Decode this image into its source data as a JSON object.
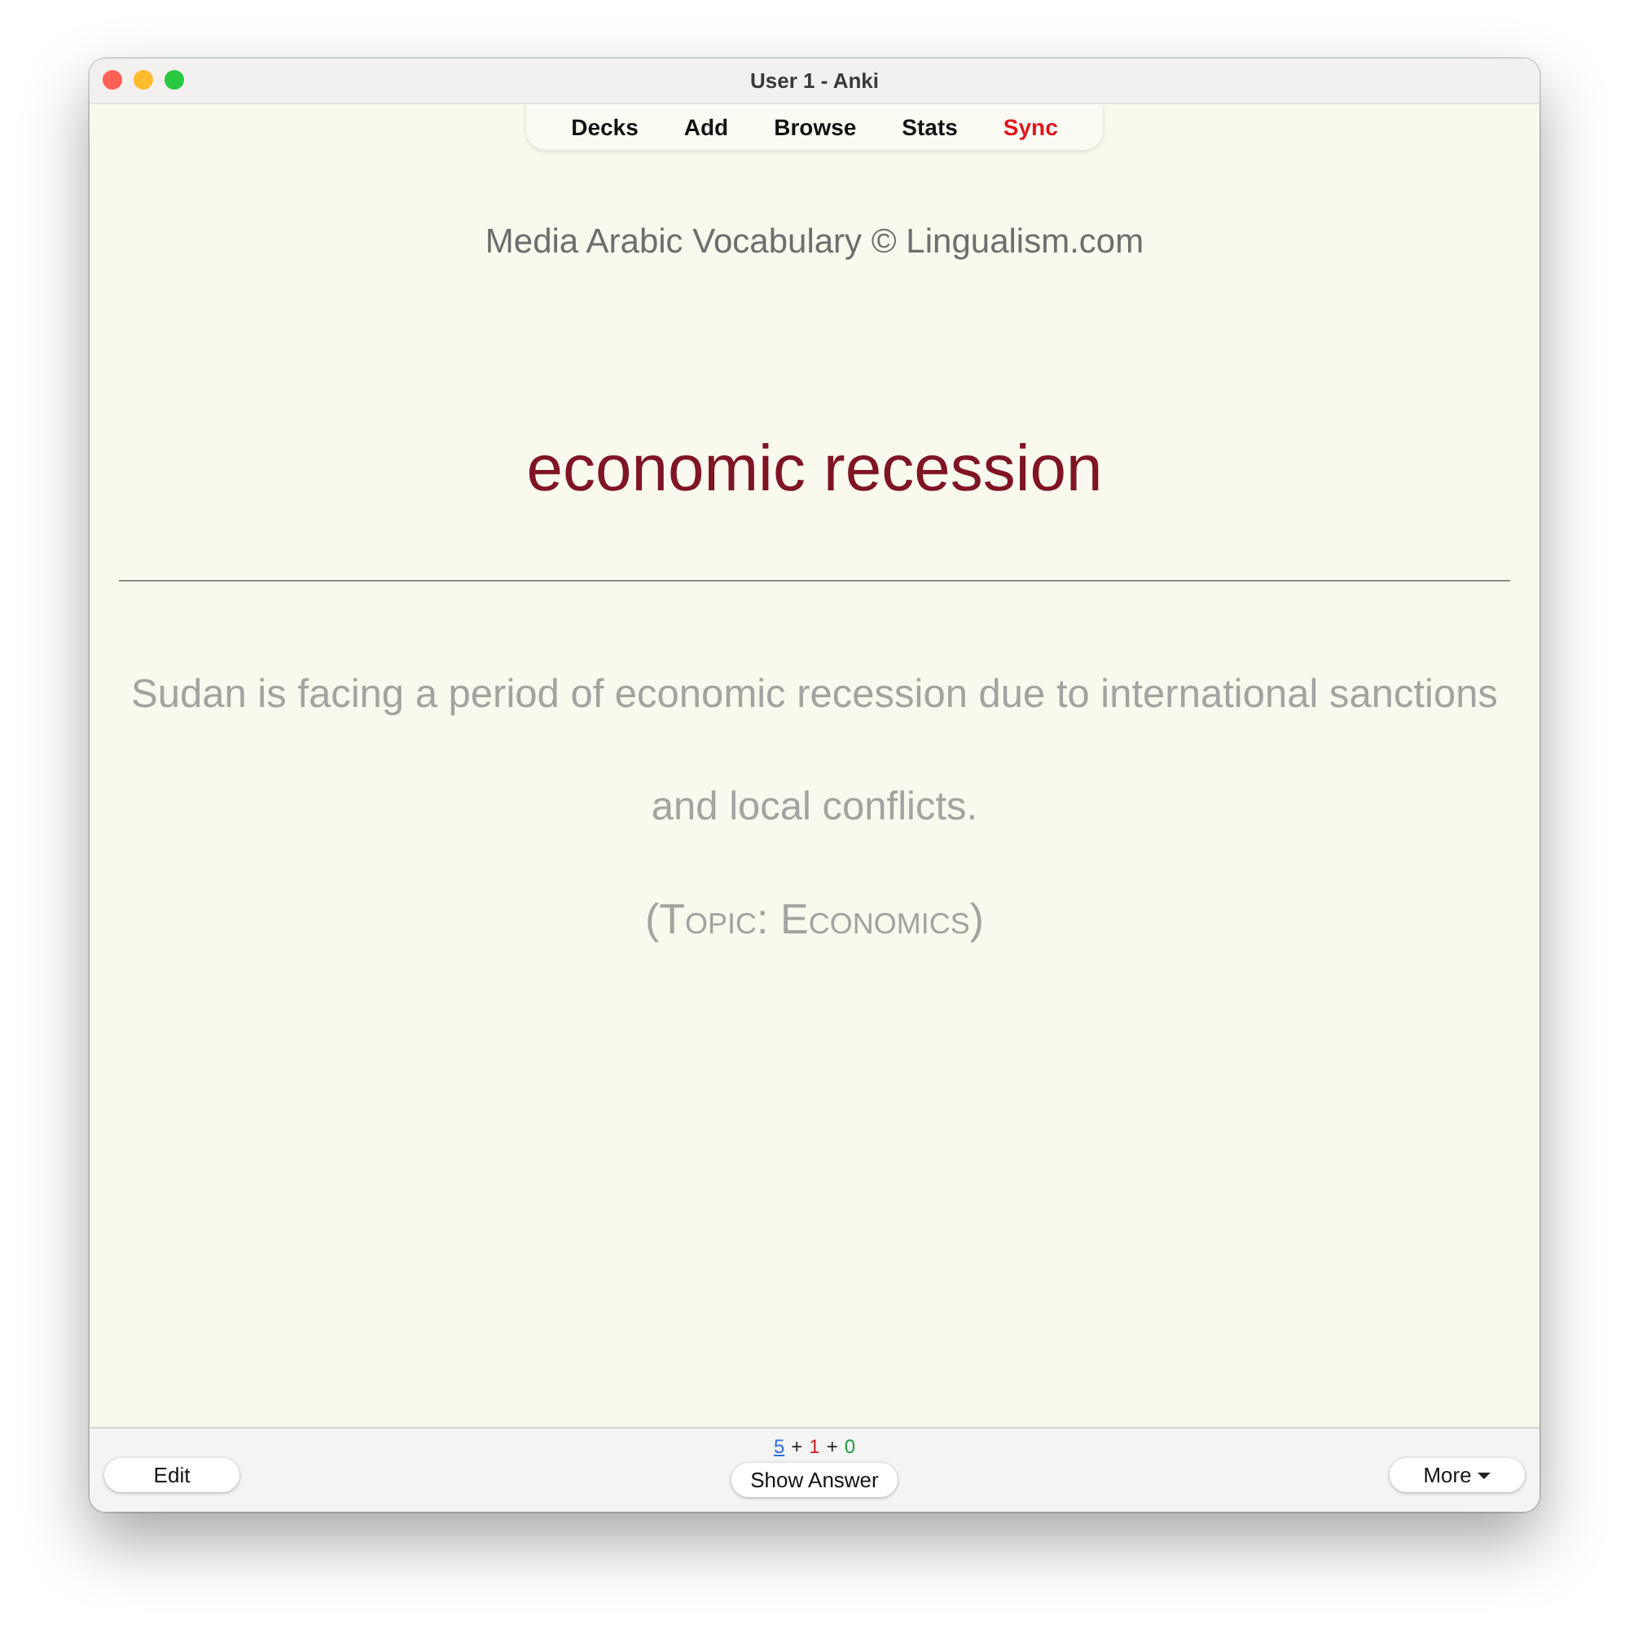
{
  "window": {
    "title": "User 1 - Anki"
  },
  "toolbar": {
    "items": [
      {
        "label": "Decks",
        "attention": false
      },
      {
        "label": "Add",
        "attention": false
      },
      {
        "label": "Browse",
        "attention": false
      },
      {
        "label": "Stats",
        "attention": false
      },
      {
        "label": "Sync",
        "attention": true
      }
    ]
  },
  "card": {
    "deck_title": "Media Arabic Vocabulary © Lingualism.com",
    "front": "economic recession",
    "example": "Sudan is facing a period of economic recession due to international sanctions and local conflicts.",
    "topic": "(Topic: Economics)"
  },
  "bottom_bar": {
    "edit_button": "Edit",
    "due_counts": [
      {
        "kind": "count",
        "text": "5",
        "color": "#2f6fdf",
        "current": true
      },
      {
        "kind": "sign",
        "text": "+"
      },
      {
        "kind": "count",
        "text": "1",
        "color": "#c8212c",
        "current": false
      },
      {
        "kind": "sign",
        "text": "+"
      },
      {
        "kind": "count",
        "text": "0",
        "color": "#1e9a3c",
        "current": false
      }
    ],
    "show_answer_button": "Show Answer",
    "more_button": "More"
  }
}
